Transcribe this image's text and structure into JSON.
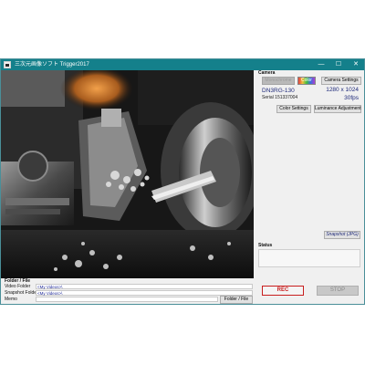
{
  "window": {
    "title": "三次元画像ソフト Trigger2017",
    "minimize_glyph": "—",
    "maximize_glyph": "☐",
    "close_glyph": "✕"
  },
  "camera": {
    "section_label": "Camera",
    "mode_monochrome": "Monochrome",
    "mode_color": "Color",
    "settings_button": "Camera Settings",
    "model": "DN3RG-130",
    "serial": "Serial 151337004",
    "resolution": "1280 x 1024",
    "fps": "30fps",
    "color_settings_button": "Color Settings",
    "luminance_button": "Luminance Adjustment",
    "snapshot_button": "Snapshot (JPG)"
  },
  "status": {
    "section_label": "Status",
    "text": ""
  },
  "controls": {
    "rec_label": "REC",
    "stop_label": "STOP"
  },
  "folder": {
    "section_label": "Folder / File",
    "video_label": "Video Folder",
    "video_value": "<My Videos>\\",
    "snapshot_label": "Snapshot Folder",
    "snapshot_value": "<My Videos>\\",
    "memo_label": "Memo",
    "memo_value": "",
    "button_label": "Folder / File"
  },
  "colors": {
    "titlebar": "#14808b",
    "rec_text": "#c81e1e",
    "rec_border": "#c81e1e"
  },
  "icons": {
    "app": "app-window-icon"
  }
}
